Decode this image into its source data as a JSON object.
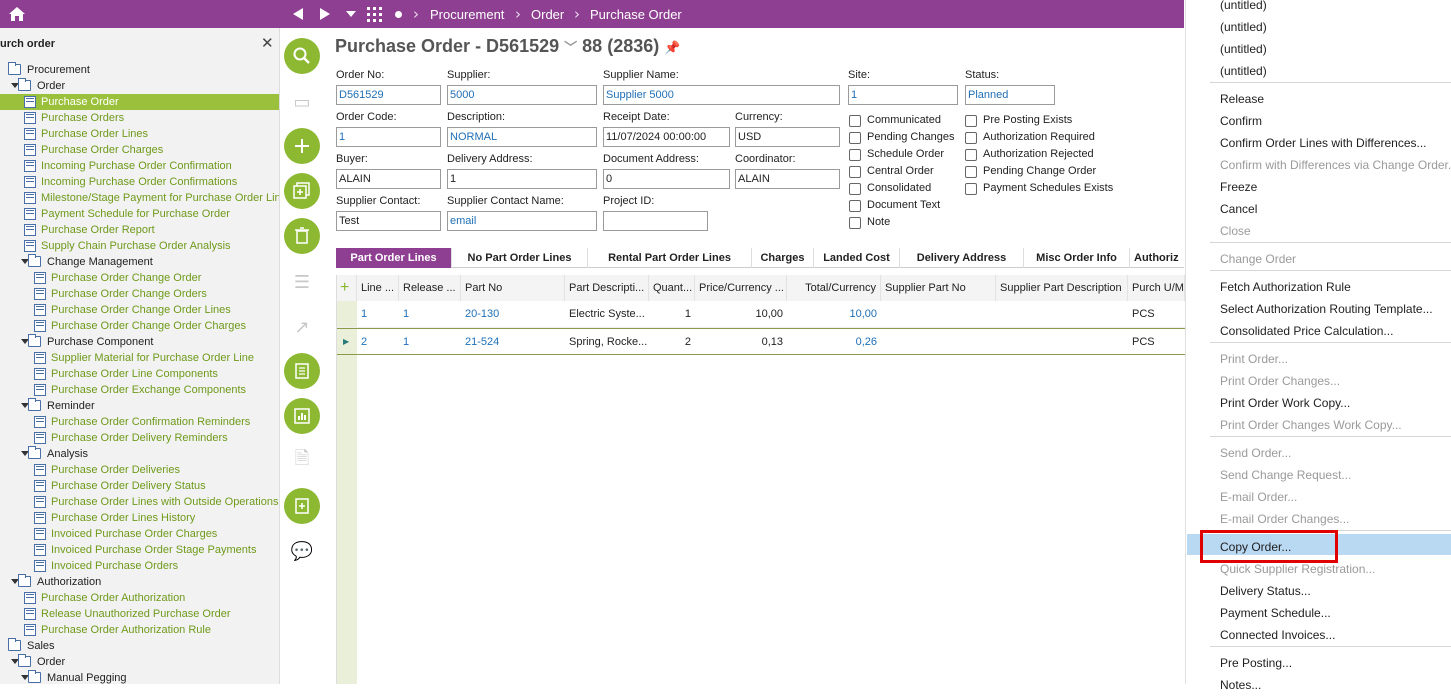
{
  "topbar": {
    "breadcrumbs": [
      "Procurement",
      "Order",
      "Purchase Order"
    ],
    "icons": [
      "home-icon",
      "back-icon",
      "forward-icon",
      "dropdown-icon",
      "apps-icon",
      "dot-icon"
    ]
  },
  "nav": {
    "search_text": "urch order",
    "items": [
      {
        "label": "Procurement",
        "kind": "folder",
        "level": 0,
        "caret": false
      },
      {
        "label": "Order",
        "kind": "folder",
        "level": 1,
        "caret": true
      },
      {
        "label": "Purchase Order",
        "kind": "page",
        "level": 2,
        "selected": true
      },
      {
        "label": "Purchase Orders",
        "kind": "page",
        "level": 2
      },
      {
        "label": "Purchase Order Lines",
        "kind": "page",
        "level": 2
      },
      {
        "label": "Purchase Order Charges",
        "kind": "page",
        "level": 2
      },
      {
        "label": "Incoming Purchase Order Confirmation",
        "kind": "page",
        "level": 2
      },
      {
        "label": "Incoming Purchase Order Confirmations",
        "kind": "page",
        "level": 2
      },
      {
        "label": "Milestone/Stage Payment for Purchase Order Line",
        "kind": "page",
        "level": 2
      },
      {
        "label": "Payment Schedule for Purchase Order",
        "kind": "page",
        "level": 2
      },
      {
        "label": "Purchase Order Report",
        "kind": "page",
        "level": 2
      },
      {
        "label": "Supply Chain Purchase Order Analysis",
        "kind": "page",
        "level": 2
      },
      {
        "label": "Change Management",
        "kind": "folder",
        "level": 2,
        "caret": true
      },
      {
        "label": "Purchase Order Change Order",
        "kind": "page",
        "level": 3
      },
      {
        "label": "Purchase Order Change Orders",
        "kind": "page",
        "level": 3
      },
      {
        "label": "Purchase Order Change Order Lines",
        "kind": "page",
        "level": 3
      },
      {
        "label": "Purchase Order Change Order Charges",
        "kind": "page",
        "level": 3
      },
      {
        "label": "Purchase Component",
        "kind": "folder",
        "level": 2,
        "caret": true
      },
      {
        "label": "Supplier Material for Purchase Order Line",
        "kind": "page",
        "level": 3
      },
      {
        "label": "Purchase Order Line Components",
        "kind": "page",
        "level": 3
      },
      {
        "label": "Purchase Order Exchange Components",
        "kind": "page",
        "level": 3
      },
      {
        "label": "Reminder",
        "kind": "folder",
        "level": 2,
        "caret": true
      },
      {
        "label": "Purchase Order Confirmation Reminders",
        "kind": "page",
        "level": 3
      },
      {
        "label": "Purchase Order Delivery Reminders",
        "kind": "page",
        "level": 3
      },
      {
        "label": "Analysis",
        "kind": "folder",
        "level": 2,
        "caret": true
      },
      {
        "label": "Purchase Order Deliveries",
        "kind": "page",
        "level": 3
      },
      {
        "label": "Purchase Order Delivery Status",
        "kind": "page",
        "level": 3
      },
      {
        "label": "Purchase Order Lines with Outside Operations",
        "kind": "page",
        "level": 3
      },
      {
        "label": "Purchase Order Lines History",
        "kind": "page",
        "level": 3
      },
      {
        "label": "Invoiced Purchase Order Charges",
        "kind": "page",
        "level": 3
      },
      {
        "label": "Invoiced Purchase Order Stage Payments",
        "kind": "page",
        "level": 3
      },
      {
        "label": "Invoiced Purchase Orders",
        "kind": "page",
        "level": 3
      },
      {
        "label": "Authorization",
        "kind": "folder",
        "level": 1,
        "caret": true
      },
      {
        "label": "Purchase Order Authorization",
        "kind": "page",
        "level": 2
      },
      {
        "label": "Release Unauthorized Purchase Order",
        "kind": "page",
        "level": 2
      },
      {
        "label": "Purchase Order Authorization Rule",
        "kind": "page",
        "level": 2
      },
      {
        "label": "Sales",
        "kind": "folder",
        "level": 0,
        "caret": false
      },
      {
        "label": "Order",
        "kind": "folder",
        "level": 1,
        "caret": true
      },
      {
        "label": "Manual Pegging",
        "kind": "folder",
        "level": 2,
        "caret": true
      }
    ]
  },
  "rail": {
    "buttons": [
      {
        "icon": "search-icon",
        "disabled": false
      },
      {
        "icon": "notes-icon",
        "disabled": true
      },
      {
        "icon": "add-icon",
        "disabled": false
      },
      {
        "icon": "duplicate-icon",
        "disabled": false
      },
      {
        "icon": "delete-icon",
        "disabled": false
      },
      {
        "icon": "list-icon",
        "disabled": true
      },
      {
        "icon": "edit-icon",
        "disabled": true
      },
      {
        "icon": "details-icon",
        "disabled": false
      },
      {
        "icon": "chart-icon",
        "disabled": false
      },
      {
        "icon": "document-icon",
        "disabled": true
      },
      {
        "icon": "new-document-icon",
        "disabled": false
      },
      {
        "icon": "comment-icon",
        "disabled": true
      }
    ]
  },
  "header": {
    "title": "Purchase Order - D561529",
    "counter": "88 (2836)"
  },
  "form": {
    "order_no": {
      "label": "Order No:",
      "value": "D561529"
    },
    "supplier": {
      "label": "Supplier:",
      "value": "5000"
    },
    "supplier_name": {
      "label": "Supplier Name:",
      "value": "Supplier 5000"
    },
    "site": {
      "label": "Site:",
      "value": "1"
    },
    "status": {
      "label": "Status:",
      "value": "Planned"
    },
    "order_code": {
      "label": "Order Code:",
      "value": "1"
    },
    "description": {
      "label": "Description:",
      "value": "NORMAL"
    },
    "receipt_date": {
      "label": "Receipt Date:",
      "value": "11/07/2024 00:00:00"
    },
    "currency": {
      "label": "Currency:",
      "value": "USD"
    },
    "buyer": {
      "label": "Buyer:",
      "value": "ALAIN"
    },
    "delivery_address": {
      "label": "Delivery Address:",
      "value": "1"
    },
    "document_address": {
      "label": "Document Address:",
      "value": "0"
    },
    "coordinator": {
      "label": "Coordinator:",
      "value": "ALAIN"
    },
    "supplier_contact": {
      "label": "Supplier Contact:",
      "value": "Test"
    },
    "supplier_contact_name": {
      "label": "Supplier Contact Name:",
      "value": "email"
    },
    "project_id": {
      "label": "Project ID:",
      "value": ""
    }
  },
  "checkboxes": {
    "left": [
      "Communicated",
      "Pending Changes",
      "Schedule Order",
      "Central Order",
      "Consolidated",
      "Document Text",
      "Note"
    ],
    "right": [
      "Pre Posting Exists",
      "Authorization Required",
      "Authorization Rejected",
      "Pending Change Order",
      "Payment Schedules Exists"
    ]
  },
  "tabs": [
    "Part Order Lines",
    "No Part Order Lines",
    "Rental Part Order Lines",
    "Charges",
    "Landed Cost",
    "Delivery Address",
    "Misc Order Info",
    "Authoriz"
  ],
  "grid": {
    "columns": [
      "Line ...",
      "Release ...",
      "Part No",
      "Part Descripti...",
      "Quant...",
      "Price/Currency ...",
      "Total/Currency",
      "Supplier Part No",
      "Supplier Part Description",
      "Purch U/M"
    ],
    "rows": [
      {
        "line": "1",
        "release": "1",
        "part_no": "20-130",
        "desc": "Electric Syste...",
        "qty": "1",
        "price": "10,00",
        "total": "10,00",
        "sup_part": "",
        "sup_desc": "",
        "um": "PCS"
      },
      {
        "line": "2",
        "release": "1",
        "part_no": "21-524",
        "desc": "Spring, Rocke...",
        "qty": "2",
        "price": "0,13",
        "total": "0,26",
        "sup_part": "",
        "sup_desc": "",
        "um": "PCS"
      }
    ]
  },
  "menu": {
    "items": [
      {
        "label": "(untitled)",
        "disabled": false
      },
      {
        "label": "(untitled)",
        "disabled": false
      },
      {
        "label": "(untitled)",
        "disabled": false
      },
      {
        "label": "(untitled)",
        "disabled": false
      },
      {
        "label": "Release",
        "disabled": false
      },
      {
        "label": "Confirm",
        "disabled": false
      },
      {
        "label": "Confirm Order Lines with Differences...",
        "disabled": false
      },
      {
        "label": "Confirm with Differences via Change Order...",
        "disabled": true
      },
      {
        "label": "Freeze",
        "disabled": false
      },
      {
        "label": "Cancel",
        "disabled": false
      },
      {
        "label": "Close",
        "disabled": true
      },
      {
        "label": "Change Order",
        "disabled": true
      },
      {
        "label": "Fetch Authorization Rule",
        "disabled": false
      },
      {
        "label": "Select Authorization Routing Template...",
        "disabled": false
      },
      {
        "label": "Consolidated Price Calculation...",
        "disabled": false
      },
      {
        "label": "Print Order...",
        "disabled": true
      },
      {
        "label": "Print Order Changes...",
        "disabled": true
      },
      {
        "label": "Print Order Work Copy...",
        "disabled": false
      },
      {
        "label": "Print Order Changes Work Copy...",
        "disabled": true
      },
      {
        "label": "Send Order...",
        "disabled": true
      },
      {
        "label": "Send Change Request...",
        "disabled": true
      },
      {
        "label": "E-mail Order...",
        "disabled": true
      },
      {
        "label": "E-mail Order Changes...",
        "disabled": true
      },
      {
        "label": "Copy Order...",
        "disabled": false,
        "highlighted": true
      },
      {
        "label": "Quick Supplier Registration...",
        "disabled": true
      },
      {
        "label": "Delivery Status...",
        "disabled": false
      },
      {
        "label": "Payment Schedule...",
        "disabled": false
      },
      {
        "label": "Connected Invoices...",
        "disabled": false
      },
      {
        "label": "Pre Posting...",
        "disabled": false
      },
      {
        "label": "Notes...",
        "disabled": false
      }
    ]
  }
}
